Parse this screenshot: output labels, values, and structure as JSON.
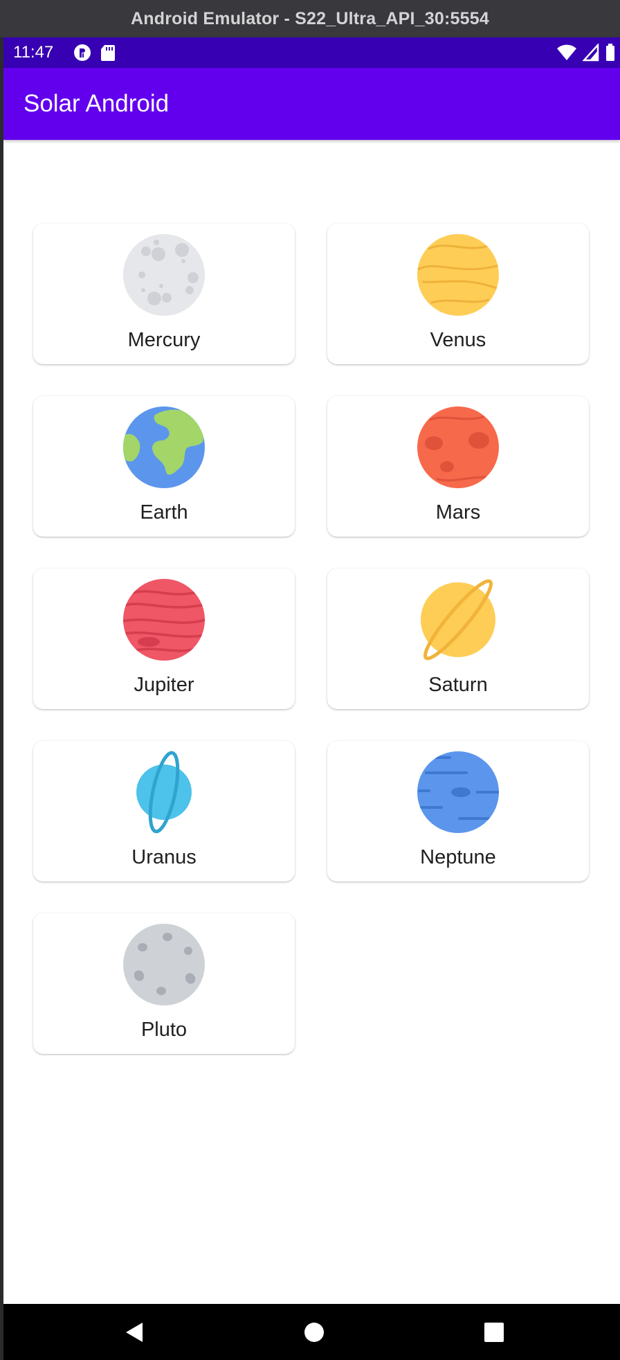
{
  "emulator": {
    "title": "Android Emulator - S22_Ultra_API_30:5554"
  },
  "status_bar": {
    "time": "11:47",
    "left_icons": [
      "profile-icon",
      "sd-card-icon"
    ],
    "right_icons": [
      "wifi-icon",
      "cell-signal-icon",
      "battery-icon"
    ]
  },
  "app_bar": {
    "title": "Solar Android",
    "color": "#6200ee",
    "status_color": "#3700b3"
  },
  "planets": [
    {
      "name": "Mercury",
      "icon": "mercury-icon",
      "color": "#e6e7ea"
    },
    {
      "name": "Venus",
      "icon": "venus-icon",
      "color": "#fecd56"
    },
    {
      "name": "Earth",
      "icon": "earth-icon",
      "color": "#5c96ec"
    },
    {
      "name": "Mars",
      "icon": "mars-icon",
      "color": "#f7694b"
    },
    {
      "name": "Jupiter",
      "icon": "jupiter-icon",
      "color": "#ef5666"
    },
    {
      "name": "Saturn",
      "icon": "saturn-icon",
      "color": "#fecd56"
    },
    {
      "name": "Uranus",
      "icon": "uranus-icon",
      "color": "#4dc2ea"
    },
    {
      "name": "Neptune",
      "icon": "neptune-icon",
      "color": "#5c96ec"
    },
    {
      "name": "Pluto",
      "icon": "pluto-icon",
      "color": "#ced1d6"
    }
  ],
  "nav_bar": {
    "buttons": [
      "back-icon",
      "home-icon",
      "recents-icon"
    ]
  }
}
